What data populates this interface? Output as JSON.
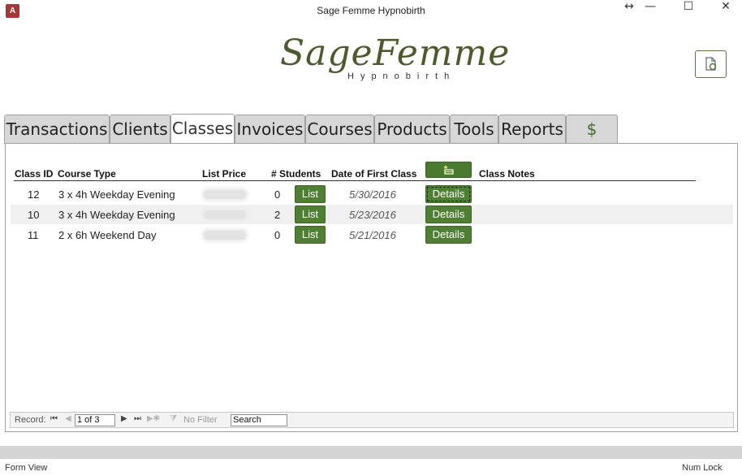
{
  "window": {
    "title": "Sage Femme Hypnobirth",
    "app_icon": "A",
    "controls": {
      "resize": "↔",
      "minimize": "—",
      "maximize": "☐",
      "close": "✕"
    }
  },
  "header": {
    "logo_main": "SageFemme",
    "logo_sub": "Hypnobirth",
    "brand_color": "#4c5a2e"
  },
  "tabs": [
    {
      "label": "Transactions"
    },
    {
      "label": "Clients"
    },
    {
      "label": "Classes",
      "active": true
    },
    {
      "label": "Invoices"
    },
    {
      "label": "Courses"
    },
    {
      "label": "Products"
    },
    {
      "label": "Tools"
    },
    {
      "label": "Reports"
    },
    {
      "label": "$"
    }
  ],
  "classes": {
    "columns": {
      "class_id": "Class ID",
      "course_type": "Course Type",
      "list_price": "List Price",
      "students": "# Students",
      "first_date": "Date of First Class",
      "notes": "Class Notes"
    },
    "rows": [
      {
        "class_id": "12",
        "course_type": "3 x 4h Weekday Evening",
        "students": "0",
        "list_label": "List",
        "first_date": "5/30/2016",
        "details_label": "Details"
      },
      {
        "class_id": "10",
        "course_type": "3 x 4h Weekday Evening",
        "students": "2",
        "list_label": "List",
        "first_date": "5/23/2016",
        "details_label": "Details"
      },
      {
        "class_id": "11",
        "course_type": "2 x 6h Weekend Day",
        "students": "0",
        "list_label": "List",
        "first_date": "5/21/2016",
        "details_label": "Details"
      }
    ],
    "button_color": "#4f7f33"
  },
  "record_nav": {
    "record_label": "Record:",
    "position": "1 of 3",
    "filter_label": "No Filter",
    "search_placeholder": "Search"
  },
  "status": {
    "left": "Form View",
    "right": "Num Lock"
  }
}
